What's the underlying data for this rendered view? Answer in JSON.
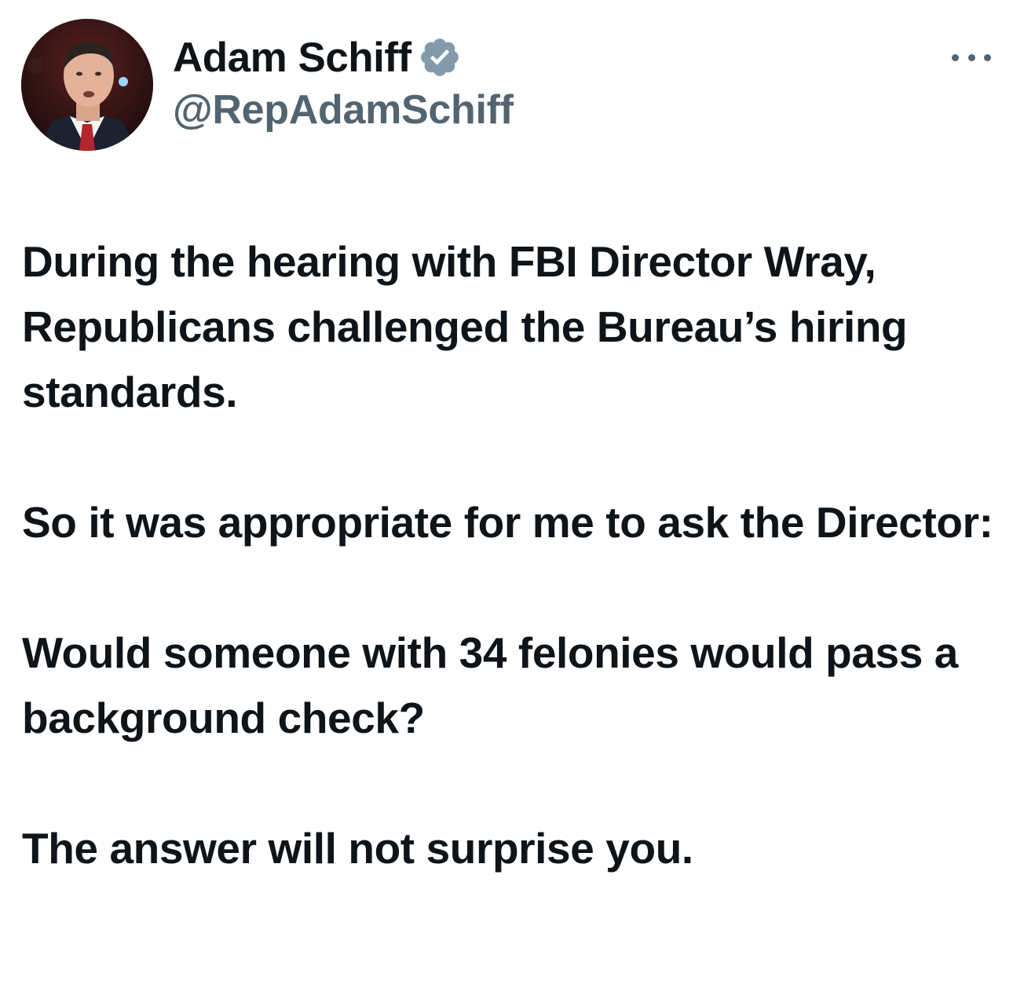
{
  "author": {
    "display_name": "Adam Schiff",
    "handle": "@RepAdamSchiff",
    "verified_icon": "verified-badge-icon",
    "verified_color": "#829aab"
  },
  "actions": {
    "more_icon": "more-options-icon"
  },
  "tweet": {
    "paragraphs": [
      "During the hearing with FBI Director Wray, Republicans challenged the Bureau’s hiring standards.",
      "So it was appropriate for me to ask the Director:",
      "Would someone with 34 felonies would pass a background check?",
      "The answer will not surprise you."
    ]
  },
  "colors": {
    "text_primary": "#0f1419",
    "text_secondary": "#536471",
    "background": "#ffffff"
  }
}
